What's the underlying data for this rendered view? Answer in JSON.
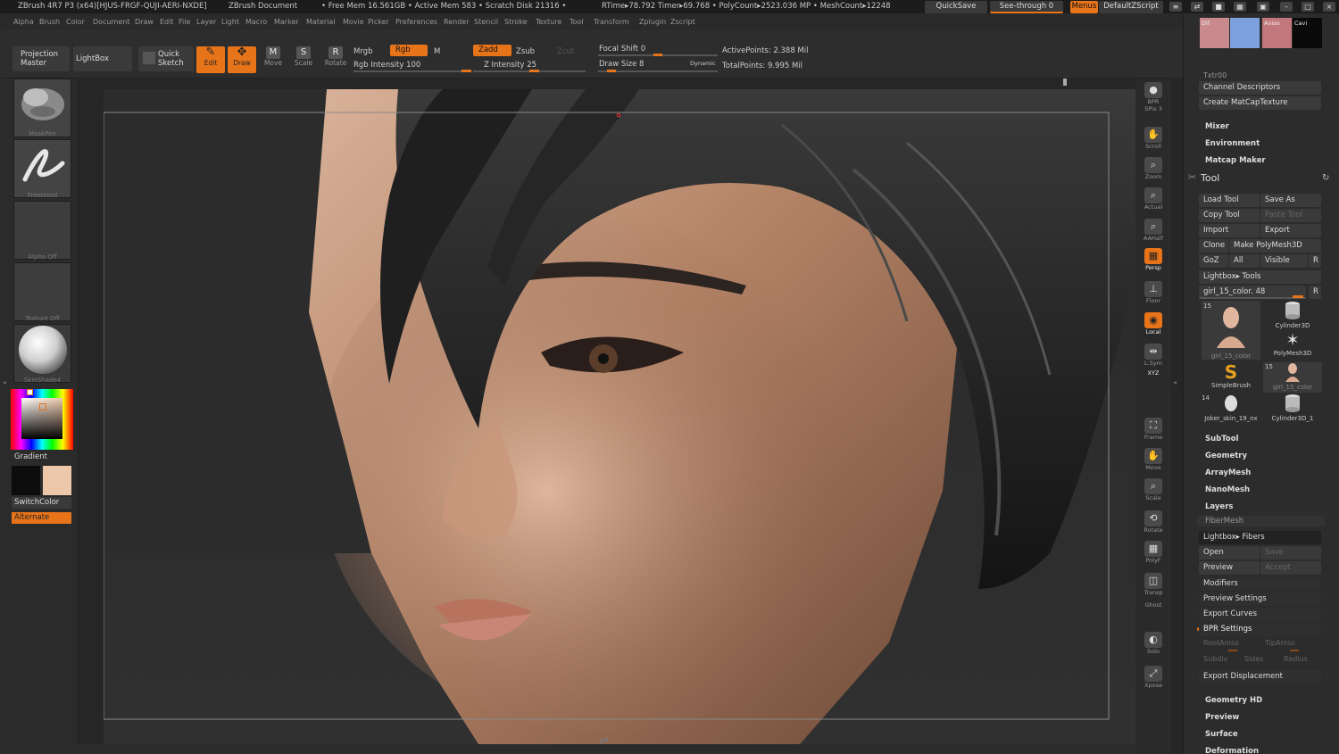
{
  "titlebar": {
    "app": "ZBrush 4R7 P3 (x64)[HJUS-FRGF-QUJI-AERI-NXDE]",
    "doc": "ZBrush Document",
    "stats": "• Free Mem 16.561GB • Active Mem 583 • Scratch Disk 21316 •",
    "stats2": "RTime▸78.792 Timer▸69.768 • PolyCount▸2523.036 MP • MeshCount▸12248",
    "quicksave": "QuickSave",
    "seethrough": "See-through  0",
    "menus": "Menus",
    "script": "DefaultZScript"
  },
  "menubar": [
    "Alpha",
    "Brush",
    "Color",
    "Document",
    "Draw",
    "Edit",
    "File",
    "Layer",
    "Light",
    "Macro",
    "Marker",
    "Material",
    "Movie",
    "Picker",
    "Preferences",
    "Render",
    "Stencil",
    "Stroke",
    "Texture",
    "Tool",
    "Transform",
    "Zplugin",
    "Zscript"
  ],
  "toolbar": {
    "projection_master": "Projection\nMaster",
    "lightbox": "LightBox",
    "quick_sketch": "Quick\nSketch",
    "edit": "Edit",
    "draw": "Draw",
    "move": "Move",
    "scale": "Scale",
    "rotate": "Rotate",
    "mrgb": "Mrgb",
    "rgb": "Rgb",
    "m": "M",
    "rgb_intensity": "Rgb Intensity 100",
    "zadd": "Zadd",
    "zsub": "Zsub",
    "zcut": "Zcut",
    "z_intensity": "Z Intensity 25",
    "focal_shift": "Focal Shift 0",
    "draw_size": "Draw Size 8",
    "dynamic": "Dynamic",
    "active_points": "ActivePoints: 2.388 Mil",
    "total_points": "TotalPoints: 9.995 Mil",
    "rgb_intensity_value": 100,
    "z_intensity_value": 25
  },
  "leftshelf": {
    "maskpen": "MaskPen",
    "freehand": "FreeHand",
    "alpha_off": "Alpha Off",
    "texture_off": "Texture Off",
    "skinshade": "SkinShade4",
    "gradient": "Gradient",
    "switchcolor": "SwitchColor",
    "alternate": "Alternate",
    "primary_color": "#0c0c0c",
    "secondary_color": "#ecc7aa"
  },
  "rightshelf": [
    {
      "label": "BPR",
      "icon": "sphere-icon"
    },
    {
      "label": "SPix 3",
      "icon": ""
    },
    {
      "label": "Scroll",
      "icon": "hand-icon"
    },
    {
      "label": "Zoom",
      "icon": "magnifier-icon"
    },
    {
      "label": "Actual",
      "icon": "magnifier-icon"
    },
    {
      "label": "AAHalf",
      "icon": "magnifier-icon"
    },
    {
      "label": "Persp",
      "icon": "grid-icon",
      "sub": "Dynamic"
    },
    {
      "label": "Floor",
      "icon": "floor-icon"
    },
    {
      "label": "Local",
      "icon": "local-icon"
    },
    {
      "label": "L.Sym",
      "icon": "sym-icon"
    },
    {
      "label": "XYZ",
      "icon": ""
    },
    {
      "label": "Frame",
      "icon": "frame-icon"
    },
    {
      "label": "Move",
      "icon": "hand-icon"
    },
    {
      "label": "Scale",
      "icon": "magnifier-icon"
    },
    {
      "label": "Rotate",
      "icon": "rotate-icon"
    },
    {
      "label": "PolyF",
      "icon": "grid-icon",
      "sub": "Line Fill"
    },
    {
      "label": "Transp",
      "icon": "transp-icon"
    },
    {
      "label": "Ghost",
      "icon": ""
    },
    {
      "label": "Solo",
      "icon": "solo-icon",
      "sub": "Dynamic"
    },
    {
      "label": "Xpose",
      "icon": "xpose-icon"
    }
  ],
  "palette": {
    "txtr": "Txtr00",
    "channel_descriptors": "Channel Descriptors",
    "create_matcap": "Create MatCapTexture",
    "mixer": "Mixer",
    "environment": "Environment",
    "matcap_maker": "Matcap Maker",
    "tool": "Tool",
    "load_tool": "Load Tool",
    "save_as": "Save As",
    "copy_tool": "Copy Tool",
    "paste_tool": "Paste Tool",
    "import": "Import",
    "export": "Export",
    "clone": "Clone",
    "make_polymesh": "Make PolyMesh3D",
    "goz": "GoZ",
    "all": "All",
    "visible": "Visible",
    "r": "R",
    "lightbox_tools": "Lightbox▸ Tools",
    "current_tool": "girl_15_color. 48",
    "tiles": [
      {
        "name": "girl_15_color",
        "count": "15"
      },
      {
        "name": "Cylinder3D",
        "count": ""
      },
      {
        "name": "PolyMesh3D",
        "count": ""
      },
      {
        "name": "SimpleBrush",
        "count": ""
      },
      {
        "name": "girl_15_color",
        "count": "15"
      },
      {
        "name": "Joker_skin_19_nx",
        "count": "14"
      },
      {
        "name": "Cylinder3D_1",
        "count": ""
      }
    ],
    "subtool": "SubTool",
    "geometry": "Geometry",
    "arraymesh": "ArrayMesh",
    "nanomesh": "NanoMesh",
    "layers": "Layers",
    "fibermesh": "FiberMesh",
    "lightbox_fibers": "Lightbox▸ Fibers",
    "open": "Open",
    "save": "Save",
    "preview": "Preview",
    "accept": "Accept",
    "modifiers": "Modifiers",
    "preview_settings": "Preview Settings",
    "export_curves": "Export Curves",
    "bpr_settings": "BPR Settings",
    "rootaniso": "RootAniso",
    "tipaniso": "TipAniso",
    "subdiv": "Subdiv",
    "sides": "Sides",
    "radius": "Radius",
    "export_displacement": "Export Displacement",
    "geometry_hd": "Geometry HD",
    "preview2": "Preview",
    "surface": "Surface",
    "deformation": "Deformation",
    "dif": "Dif",
    "aniso": "Aniso",
    "cavi": "Cavi"
  },
  "colors": {
    "accent": "#e8741a",
    "panel": "#2c2c2c",
    "button": "#3a3a3a"
  }
}
